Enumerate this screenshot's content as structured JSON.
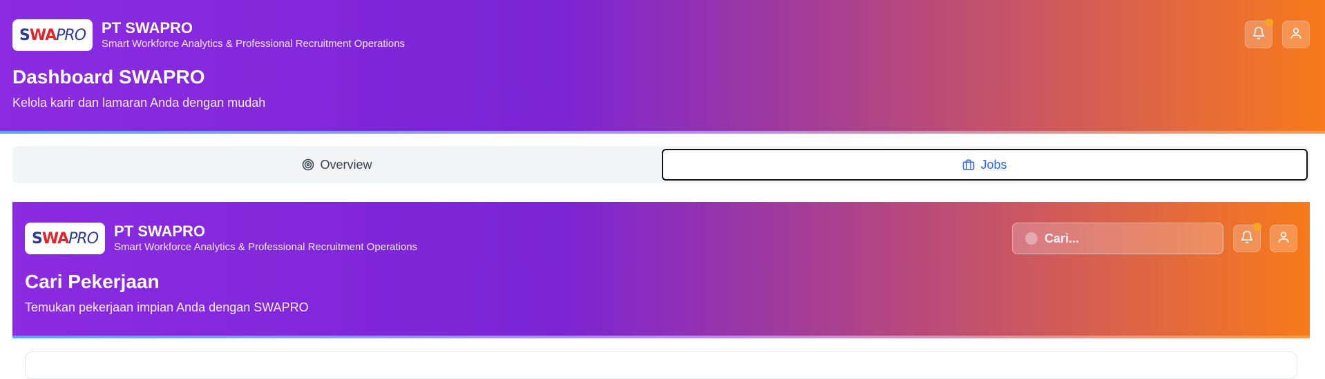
{
  "app": {
    "company_name": "PT SWAPRO",
    "tagline": "Smart Workforce Analytics & Professional Recruitment Operations",
    "logo": {
      "part1": "S",
      "part2": "WA",
      "part3": "PRO"
    }
  },
  "header": {
    "title": "Dashboard SWAPRO",
    "subtitle": "Kelola karir dan lamaran Anda dengan mudah",
    "icons": [
      "bell-icon",
      "user-icon"
    ]
  },
  "tabs": [
    {
      "label": "Overview",
      "icon": "target-icon",
      "active": false
    },
    {
      "label": "Jobs",
      "icon": "briefcase-icon",
      "active": true
    }
  ],
  "jobs_panel": {
    "company_name": "PT SWAPRO",
    "tagline": "Smart Workforce Analytics & Professional Recruitment Operations",
    "title": "Cari Pekerjaan",
    "subtitle": "Temukan pekerjaan impian Anda dengan SWAPRO",
    "search": {
      "placeholder": "Cari...",
      "value": ""
    }
  },
  "colors": {
    "gradient_start": "#8b2be2",
    "gradient_end": "#f87a1a",
    "notification_dot": "#f5a524",
    "active_tab_text": "#2563eb"
  }
}
